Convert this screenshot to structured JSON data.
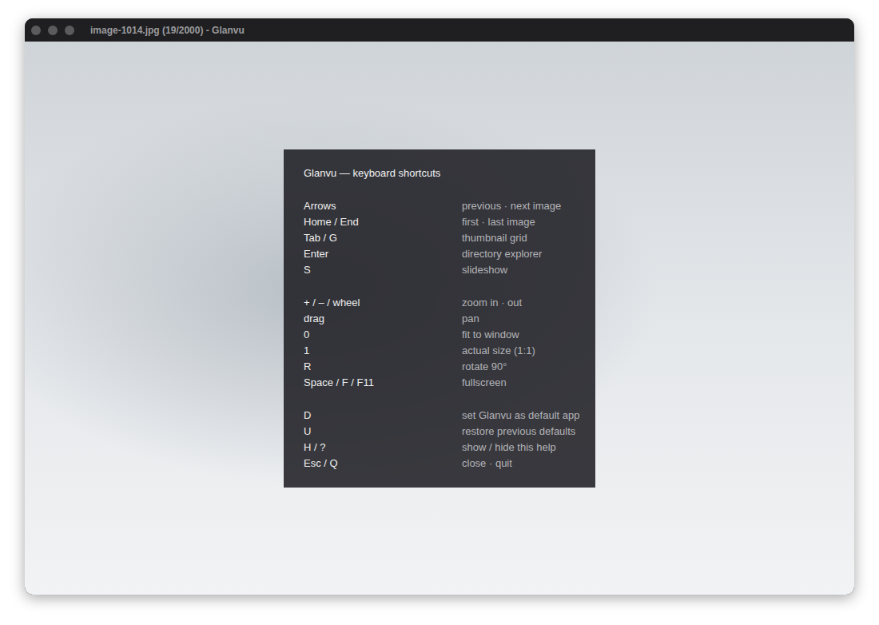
{
  "window": {
    "title": "image-1014.jpg (19/2000) - Glanvu"
  },
  "help": {
    "title": "Glanvu — keyboard shortcuts",
    "groups": [
      {
        "items": [
          {
            "keys": "Arrows",
            "action": "previous · next image"
          },
          {
            "keys": "Home / End",
            "action": "first · last image"
          },
          {
            "keys": "Tab / G",
            "action": "thumbnail grid"
          },
          {
            "keys": "Enter",
            "action": "directory explorer"
          },
          {
            "keys": "S",
            "action": "slideshow"
          }
        ]
      },
      {
        "items": [
          {
            "keys": "+ / – / wheel",
            "action": "zoom in · out"
          },
          {
            "keys": "drag",
            "action": "pan"
          },
          {
            "keys": "0",
            "action": "fit to window"
          },
          {
            "keys": "1",
            "action": "actual size (1:1)"
          },
          {
            "keys": "R",
            "action": "rotate 90°"
          },
          {
            "keys": "Space / F / F11",
            "action": "fullscreen"
          }
        ]
      },
      {
        "items": [
          {
            "keys": "D",
            "action": "set Glanvu as default app"
          },
          {
            "keys": "U",
            "action": "restore previous defaults"
          },
          {
            "keys": "H / ?",
            "action": "show / hide this help"
          },
          {
            "keys": "Esc / Q",
            "action": "close · quit"
          }
        ]
      }
    ]
  }
}
